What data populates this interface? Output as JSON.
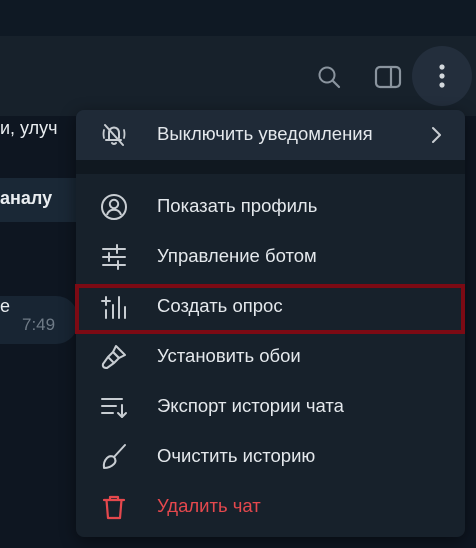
{
  "chat": {
    "fragment_top": "и, улуч",
    "fragment_link": "аналу",
    "fragment_small": "е",
    "fragment_time": "7:49"
  },
  "menu": {
    "mute": {
      "label": "Выключить уведомления",
      "icon": "bell-off-icon"
    },
    "items": [
      {
        "label": "Показать профиль",
        "icon": "profile-icon"
      },
      {
        "label": "Управление ботом",
        "icon": "sliders-icon"
      },
      {
        "label": "Создать опрос",
        "icon": "poll-icon"
      },
      {
        "label": "Установить обои",
        "icon": "brush-icon"
      },
      {
        "label": "Экспорт истории чата",
        "icon": "export-list-icon"
      },
      {
        "label": "Очистить историю",
        "icon": "broom-icon"
      },
      {
        "label": "Удалить чат",
        "icon": "trash-icon"
      }
    ]
  },
  "colors": {
    "background": "#0e1621",
    "header": "#17212b",
    "menu_bg": "#17212b",
    "text": "#e4e8ec",
    "icon": "#c8cdd2",
    "danger": "#e5484d",
    "highlight": "#7c0a14"
  }
}
